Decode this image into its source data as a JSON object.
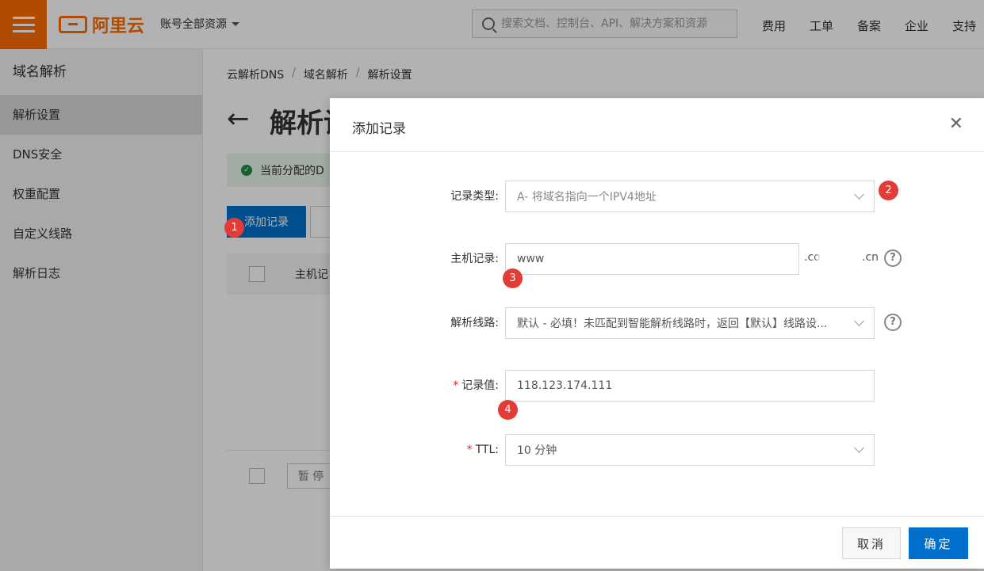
{
  "topbar": {
    "brand": "阿里云",
    "account_label": "账号全部资源",
    "search_placeholder": "搜索文档、控制台、API、解决方案和资源",
    "nav": [
      "费用",
      "工单",
      "备案",
      "企业",
      "支持"
    ]
  },
  "sidebar": {
    "title": "域名解析",
    "items": [
      "解析设置",
      "DNS安全",
      "权重配置",
      "自定义线路",
      "解析日志"
    ],
    "active_index": 0
  },
  "main": {
    "breadcrumb": [
      "云解析DNS",
      "域名解析",
      "解析设置"
    ],
    "page_title": "解析设",
    "notice": "当前分配的D",
    "add_button": "添加记录",
    "table_col": "主机记",
    "pause_button": "暂 停"
  },
  "dialog": {
    "title": "添加记录",
    "close_icon": "close-icon",
    "fields": {
      "record_type": {
        "label": "记录类型:",
        "value": "A- 将域名指向一个IPV4地址"
      },
      "host": {
        "label": "主机记录:",
        "value": "www",
        "suffix_start": ".co",
        "suffix_end": ".cn"
      },
      "line": {
        "label": "解析线路:",
        "value": "默认 - 必填！未匹配到智能解析线路时，返回【默认】线路设..."
      },
      "record_value": {
        "label": "记录值:",
        "value": "118.123.174.111"
      },
      "ttl": {
        "label": "TTL:",
        "value": "10 分钟"
      }
    },
    "cancel": "取消",
    "confirm": "确定"
  },
  "annotations": {
    "badge1": "1",
    "badge2": "2",
    "badge3": "3",
    "badge4": "4"
  },
  "colors": {
    "brand_orange": "#ff6a00",
    "primary_blue": "#0070cc",
    "badge_red": "#e33b36"
  }
}
